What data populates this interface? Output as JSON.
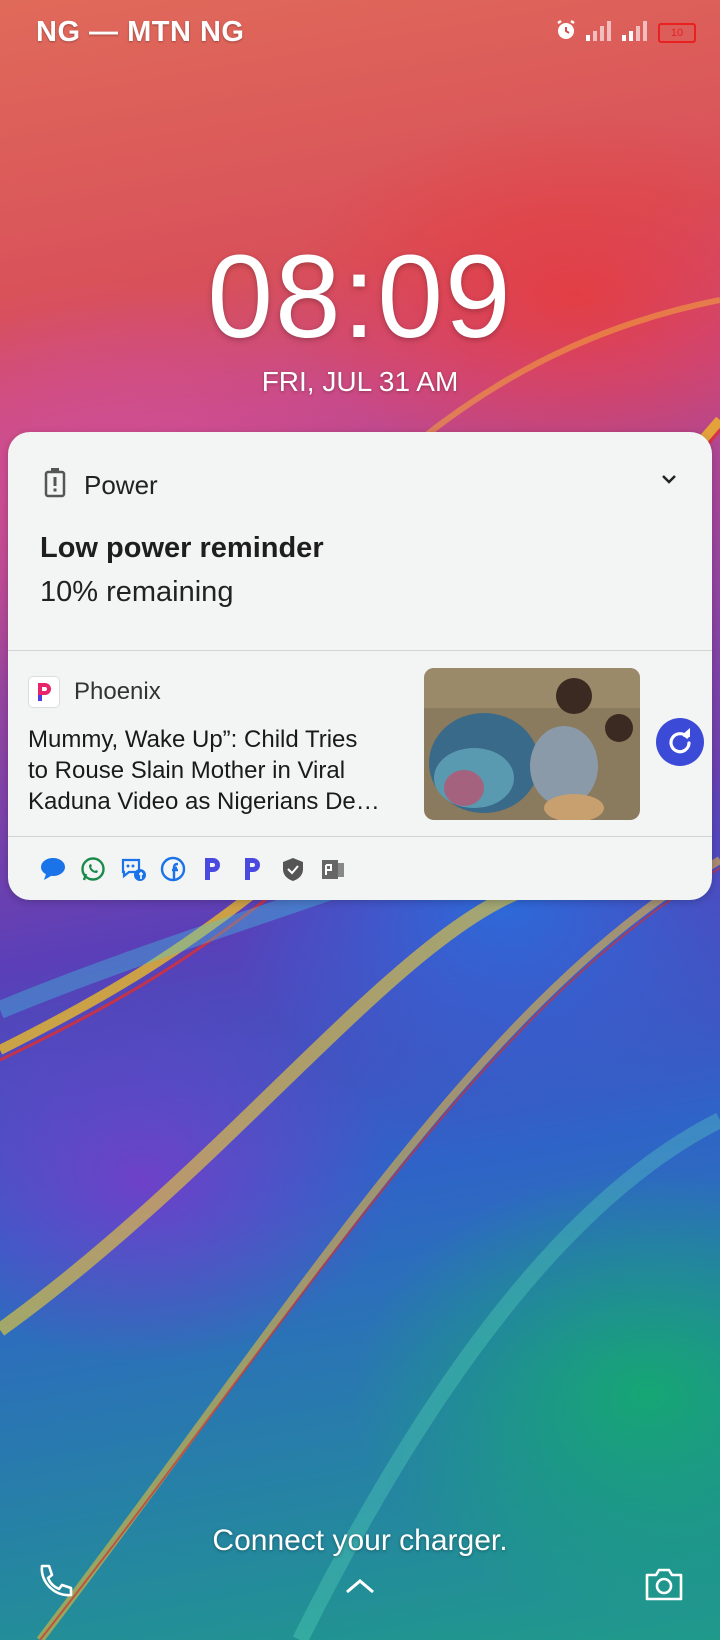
{
  "status_bar": {
    "carrier": "NG — MTN NG",
    "battery_level": "10"
  },
  "lockscreen": {
    "time": "08:09",
    "date": "FRI, JUL 31  AM",
    "hint": "Connect your charger."
  },
  "power_notification": {
    "app_name": "Power",
    "title": "Low power reminder",
    "text": "10% remaining"
  },
  "news_notification": {
    "app_name": "Phoenix",
    "headline_lines": [
      "Mummy, Wake Up”: Child Tries",
      "to Rouse Slain Mother in Viral",
      "Kaduna Video as Nigerians De…"
    ]
  },
  "notification_app_icons": [
    "messages-icon",
    "whatsapp-icon",
    "messenger-icon",
    "facebook-icon",
    "phoenix-icon",
    "phoenix-icon",
    "shield-icon",
    "wps-office-icon"
  ],
  "colors": {
    "accent": "#3b4bd8",
    "battery_low": "#e82020",
    "card_bg": "#f3f4f4"
  }
}
